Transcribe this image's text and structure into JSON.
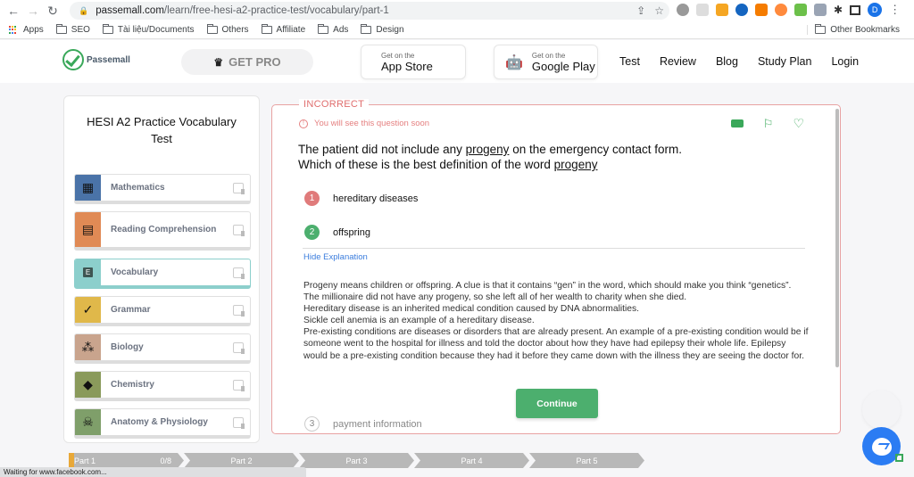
{
  "browser": {
    "url_domain": "passemall.com",
    "url_path": "/learn/free-hesi-a2-practice-test/vocabulary/part-1",
    "profile_initial": "D",
    "bookmarks": [
      "Apps",
      "SEO",
      "Tài liệu/Documents",
      "Others",
      "Affiliate",
      "Ads",
      "Design"
    ],
    "other_bookmarks": "Other Bookmarks",
    "status": "Waiting for www.facebook.com..."
  },
  "header": {
    "logo_text": "Passemall",
    "get_pro": "GET PRO",
    "app_store": {
      "small": "Get on the",
      "big": "App Store"
    },
    "google_play": {
      "small": "Get on the",
      "big": "Google Play"
    },
    "nav": [
      "Test",
      "Review",
      "Blog",
      "Study Plan",
      "Login"
    ]
  },
  "sidebar": {
    "title": "HESI A2 Practice Vocabulary Test",
    "subjects": [
      {
        "label": "Mathematics",
        "icon": "calculator-icon",
        "color": "#4a73a8"
      },
      {
        "label": "Reading Comprehension",
        "icon": "document-icon",
        "color": "#e08a55"
      },
      {
        "label": "Vocabulary",
        "icon": "letter-e-icon",
        "color": "#8ccfcc"
      },
      {
        "label": "Grammar",
        "icon": "check-circle-icon",
        "color": "#e0b84a"
      },
      {
        "label": "Biology",
        "icon": "hand-cells-icon",
        "color": "#c9a48d"
      },
      {
        "label": "Chemistry",
        "icon": "drop-icon",
        "color": "#8a9a5b"
      },
      {
        "label": "Anatomy & Physiology",
        "icon": "skull-icon",
        "color": "#7f9f6a"
      }
    ]
  },
  "question": {
    "status": "INCORRECT",
    "notice": "You will see this question soon",
    "text_line1_before": "The patient did not include any ",
    "keyword": "progeny",
    "text_line1_after": " on the emergency contact form.",
    "text_line2_before": "Which of these is the best definition of the word ",
    "options": [
      {
        "num": "1",
        "text": "hereditary diseases",
        "state": "wrong"
      },
      {
        "num": "2",
        "text": "offspring",
        "state": "correct"
      },
      {
        "num": "3",
        "text": "payment information",
        "state": "neutral"
      }
    ],
    "hide_explanation": "Hide Explanation",
    "explanation": [
      "Progeny means children or offspring. A clue is that it contains “gen” in the word, which should make you think “genetics”.",
      "The millionaire did not have any progeny, so she left all of her wealth to charity when she died.",
      "Hereditary disease is an inherited medical condition caused by DNA abnormalities.",
      "Sickle cell anemia is an example of a hereditary disease.",
      "Pre-existing conditions are diseases or disorders that are already present. An example of a pre-existing condition would be if someone went to the hospital for illness and told the doctor about how they have had epilepsy their whole life. Epilepsy would be a pre-existing condition because they had it before they came down with the illness they are seeing the doctor for."
    ],
    "continue": "Continue"
  },
  "progress": {
    "parts": [
      {
        "label": "Part 1",
        "count": "0/8",
        "fill_fraction": 0.05
      },
      {
        "label": "Part 2"
      },
      {
        "label": "Part 3"
      },
      {
        "label": "Part 4"
      },
      {
        "label": "Part 5"
      }
    ]
  },
  "colors": {
    "accent_green": "#4caf6e",
    "incorrect_red": "#e06e6e",
    "link_blue": "#3b7ddd",
    "progress_orange": "#e8a838"
  }
}
